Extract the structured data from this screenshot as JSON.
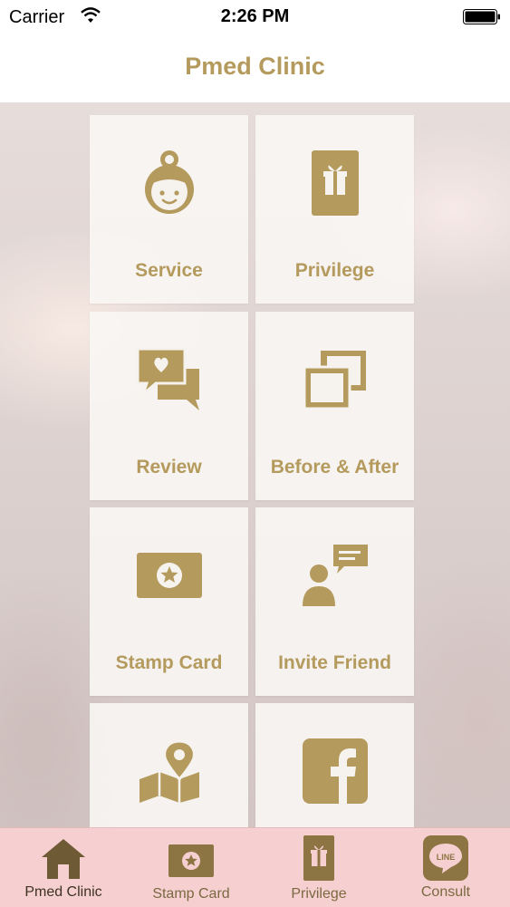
{
  "status_bar": {
    "carrier": "Carrier",
    "time": "2:26 PM"
  },
  "header": {
    "title": "Pmed Clinic"
  },
  "menu": {
    "items": [
      {
        "label": "Service",
        "icon": "doctor-icon"
      },
      {
        "label": "Privilege",
        "icon": "gift-card-icon"
      },
      {
        "label": "Review",
        "icon": "chat-heart-icon"
      },
      {
        "label": "Before & After",
        "icon": "photos-icon"
      },
      {
        "label": "Stamp Card",
        "icon": "stamp-card-icon"
      },
      {
        "label": "Invite Friend",
        "icon": "invite-friend-icon"
      },
      {
        "label": "",
        "icon": "map-pin-icon"
      },
      {
        "label": "",
        "icon": "facebook-icon"
      }
    ]
  },
  "tab_bar": {
    "tabs": [
      {
        "label": "Pmed Clinic",
        "icon": "home-icon",
        "active": true
      },
      {
        "label": "Stamp Card",
        "icon": "stamp-card-icon"
      },
      {
        "label": "Privilege",
        "icon": "gift-card-icon"
      },
      {
        "label": "Consult",
        "icon": "line-icon"
      }
    ],
    "line_badge": "LINE"
  },
  "colors": {
    "accent": "#b49a5c",
    "tab_bar_bg": "#f6cfd1",
    "tab_icon": "#7a6a40"
  }
}
